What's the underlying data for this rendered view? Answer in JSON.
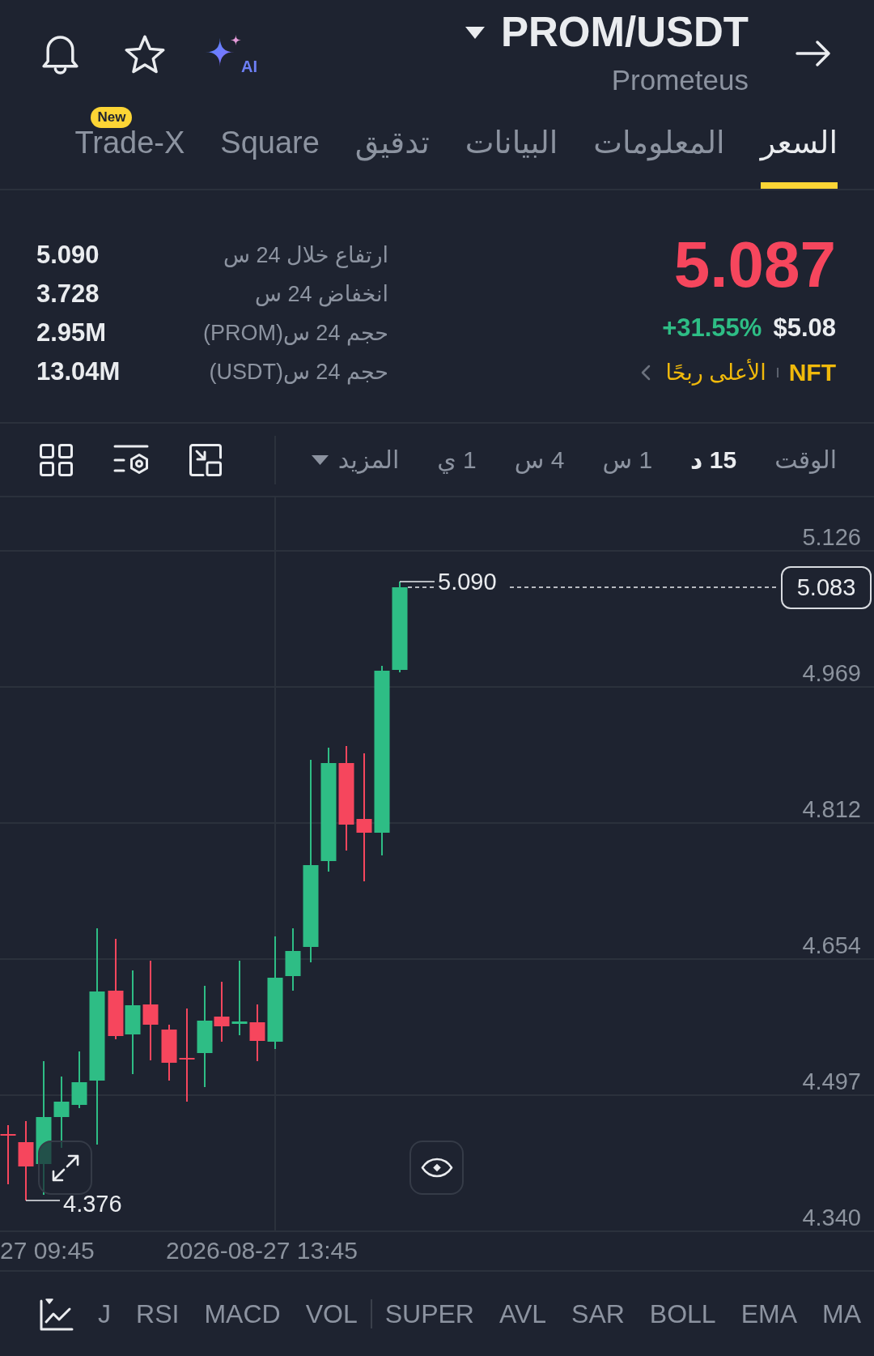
{
  "header": {
    "pair": "PROM/USDT",
    "name": "Prometeus",
    "ai_label": "AI"
  },
  "tabs": [
    {
      "label": "السعر",
      "selected": true
    },
    {
      "label": "المعلومات",
      "selected": false
    },
    {
      "label": "البيانات",
      "selected": false
    },
    {
      "label": "تدقيق",
      "selected": false
    },
    {
      "label": "Square",
      "selected": false
    },
    {
      "label": "Trade-X",
      "selected": false,
      "badge": "New"
    }
  ],
  "stats": [
    {
      "label": "ارتفاع خلال 24 س",
      "value": "5.090"
    },
    {
      "label": "انخفاض 24 س",
      "value": "3.728"
    },
    {
      "label": "حجم 24 س(PROM)",
      "value": "2.95M"
    },
    {
      "label": "حجم 24 س(USDT)",
      "value": "13.04M"
    }
  ],
  "price": {
    "last": "5.087",
    "last_rising": false,
    "change": "+31.55%",
    "change_rising": true,
    "usd": "$5.08"
  },
  "tag": {
    "label": "NFT",
    "text": "الأعلى ربحًا"
  },
  "timeframes": {
    "label": "الوقت",
    "items": [
      {
        "label": "15 د",
        "selected": true
      },
      {
        "label": "1 س",
        "selected": false
      },
      {
        "label": "4 س",
        "selected": false
      },
      {
        "label": "1 ي",
        "selected": false
      }
    ],
    "more": "المزيد"
  },
  "chart": {
    "price_axis": [
      "5.126",
      "4.969",
      "4.812",
      "4.654",
      "4.497",
      "4.340"
    ],
    "high_label": "5.090",
    "low_label": "4.376",
    "current_price": "5.083",
    "time_axis": [
      "2026-08-27 13:45",
      "27 09:45"
    ]
  },
  "indicator_groups": [
    {
      "items": [
        {
          "label": "MA",
          "selected": false
        },
        {
          "label": "EMA",
          "selected": false
        },
        {
          "label": "BOLL",
          "selected": false
        },
        {
          "label": "SAR",
          "selected": false
        },
        {
          "label": "AVL",
          "selected": false
        },
        {
          "label": "SUPER",
          "selected": false
        }
      ]
    },
    {
      "items": [
        {
          "label": "VOL",
          "selected": false
        },
        {
          "label": "MACD",
          "selected": false
        },
        {
          "label": "RSI",
          "selected": false
        },
        {
          "label": "J",
          "selected": false
        }
      ]
    }
  ]
}
